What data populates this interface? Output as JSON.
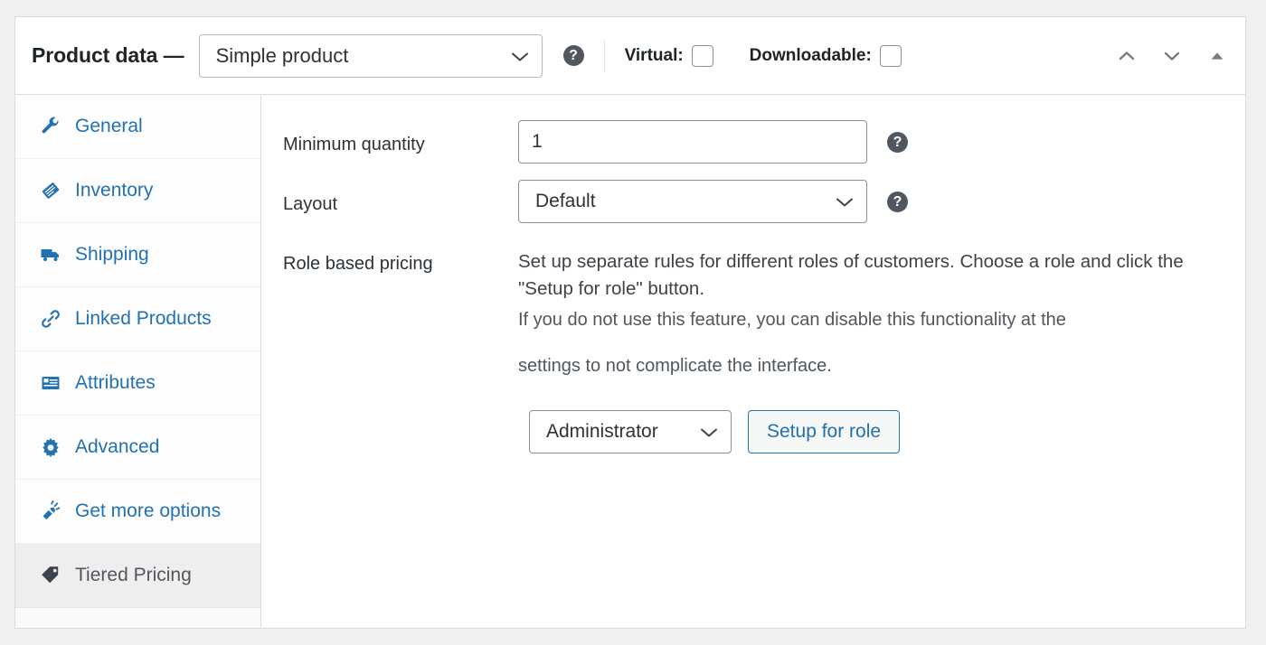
{
  "header": {
    "title": "Product data —",
    "product_type": {
      "value": "Simple product",
      "icon": "chevron-down-icon"
    },
    "help_icon": "?",
    "virtual": {
      "label": "Virtual:",
      "checked": false
    },
    "downloadable": {
      "label": "Downloadable:",
      "checked": false
    },
    "controls": [
      {
        "name": "move-up-icon"
      },
      {
        "name": "move-down-icon"
      },
      {
        "name": "toggle-panel-icon"
      }
    ]
  },
  "tabs": [
    {
      "label": "General",
      "icon": "wrench-icon",
      "active": false
    },
    {
      "label": "Inventory",
      "icon": "tag-pencil-icon",
      "active": false
    },
    {
      "label": "Shipping",
      "icon": "truck-icon",
      "active": false
    },
    {
      "label": "Linked Products",
      "icon": "link-icon",
      "active": false
    },
    {
      "label": "Attributes",
      "icon": "list-box-icon",
      "active": false
    },
    {
      "label": "Advanced",
      "icon": "gear-icon",
      "active": false
    },
    {
      "label": "Get more options",
      "icon": "plug-icon",
      "active": false
    },
    {
      "label": "Tiered Pricing",
      "icon": "price-tag-icon",
      "active": true
    }
  ],
  "options": {
    "minimum_quantity": {
      "label": "Minimum quantity",
      "value": "1",
      "help_icon": "?"
    },
    "layout": {
      "label": "Layout",
      "value": "Default",
      "help_icon": "?"
    },
    "role_based_pricing": {
      "label": "Role based pricing",
      "description_line1": "Set up separate rules for different roles of customers. Choose a role and click the \"Setup for role\" button.",
      "description_line2": "If you do not use this feature, you can disable this functionality at the",
      "description_line3": "settings to not complicate the interface.",
      "role_value": "Administrator",
      "setup_button_label": "Setup for role"
    }
  },
  "colors": {
    "link_blue": "#2271b1",
    "text_dark": "#1d2327",
    "text_muted": "#50575e",
    "panel_border": "#dcdcde",
    "active_tab_bg": "#eeeeee",
    "page_bg": "#f0f0f1"
  }
}
